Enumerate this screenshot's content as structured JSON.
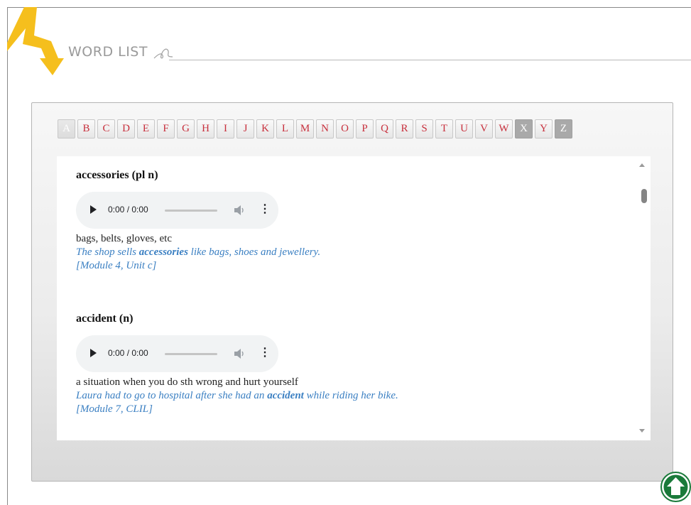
{
  "header": {
    "title": "WORD LIST"
  },
  "alphabet": {
    "letters": [
      "A",
      "B",
      "C",
      "D",
      "E",
      "F",
      "G",
      "H",
      "I",
      "J",
      "K",
      "L",
      "M",
      "N",
      "O",
      "P",
      "Q",
      "R",
      "S",
      "T",
      "U",
      "V",
      "W",
      "X",
      "Y",
      "Z"
    ],
    "selected": "A",
    "disabled": [
      "X",
      "Z"
    ]
  },
  "entries": [
    {
      "word": "accessories (pl n)",
      "audio_time": "0:00 / 0:00",
      "definition": "bags, belts, gloves, etc",
      "example_before": "The shop sells ",
      "example_key": "accessories",
      "example_after": " like bags, shoes and jewellery.",
      "reference": "[Module 4, Unit c]"
    },
    {
      "word": "accident (n)",
      "audio_time": "0:00 / 0:00",
      "definition": "a situation when you do sth wrong and hurt yourself",
      "example_before": "Laura had to go to hospital after she had an ",
      "example_key": "accident",
      "example_after": " while riding her bike.",
      "reference": "[Module 7, CLIL]"
    }
  ],
  "colors": {
    "letter_text": "#c8303d",
    "example_text": "#3a7fc2",
    "bolt": "#f5bf1d",
    "home_button": "#1a7a3a"
  },
  "icons": {
    "bolt": "lightning-bolt-icon",
    "home": "home-icon",
    "play": "play-icon",
    "volume": "volume-icon",
    "more": "more-vertical-icon"
  }
}
